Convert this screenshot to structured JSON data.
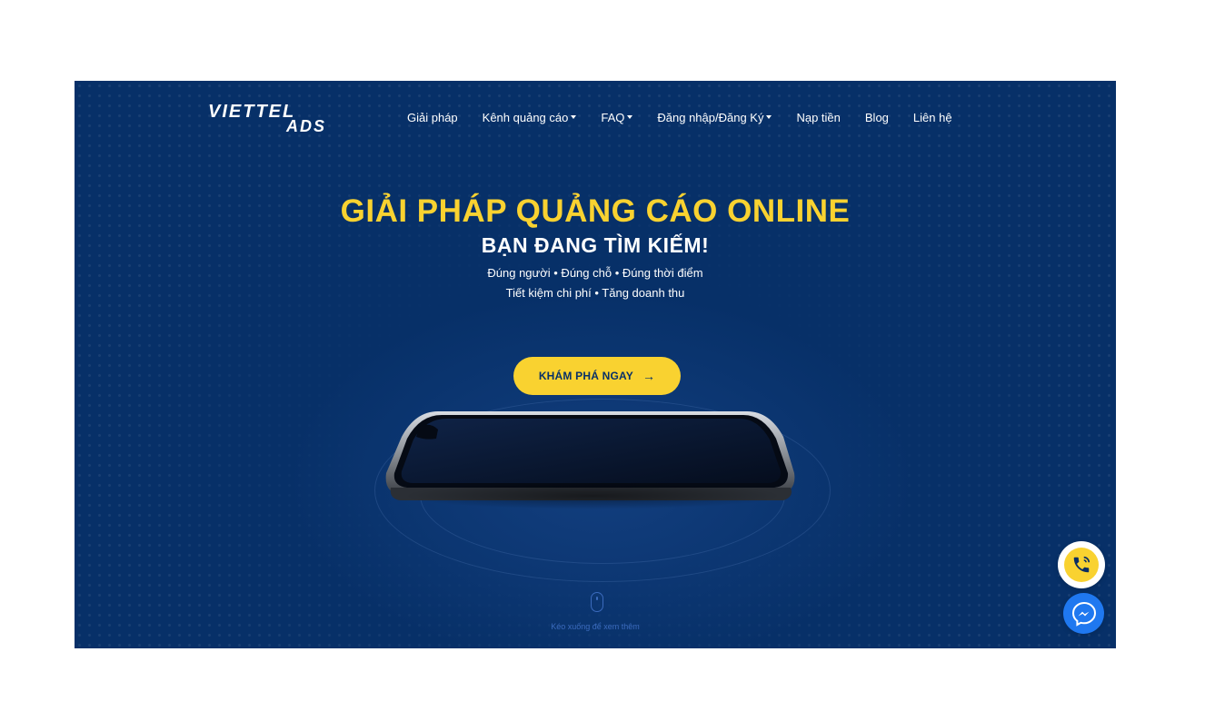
{
  "brand": {
    "logo_top": "VIETTEL",
    "logo_bottom": "ADS"
  },
  "nav": {
    "items": [
      {
        "label": "Giải pháp",
        "dropdown": false
      },
      {
        "label": "Kênh quảng cáo",
        "dropdown": true
      },
      {
        "label": "FAQ",
        "dropdown": true
      },
      {
        "label": "Đăng nhập/Đăng Ký",
        "dropdown": true
      },
      {
        "label": "Nạp tiền",
        "dropdown": false
      },
      {
        "label": "Blog",
        "dropdown": false
      },
      {
        "label": "Liên hệ",
        "dropdown": false
      }
    ]
  },
  "hero": {
    "headline": "GIẢI PHÁP QUẢNG CÁO ONLINE",
    "subheadline": "BẠN ĐANG TÌM KIẾM!",
    "line1": "Đúng người • Đúng chỗ • Đúng thời điểm",
    "line2": "Tiết kiệm chi phí • Tăng doanh thu",
    "cta_label": "KHÁM PHÁ NGAY",
    "cta_arrow": "→",
    "scroll_hint": "Kéo xuống để xem thêm"
  },
  "floating": {
    "call_icon": "phone-icon",
    "messenger_icon": "messenger-icon"
  },
  "colors": {
    "hero_bg": "#073068",
    "accent_yellow": "#f9d230",
    "messenger_blue": "#1f78f0"
  }
}
